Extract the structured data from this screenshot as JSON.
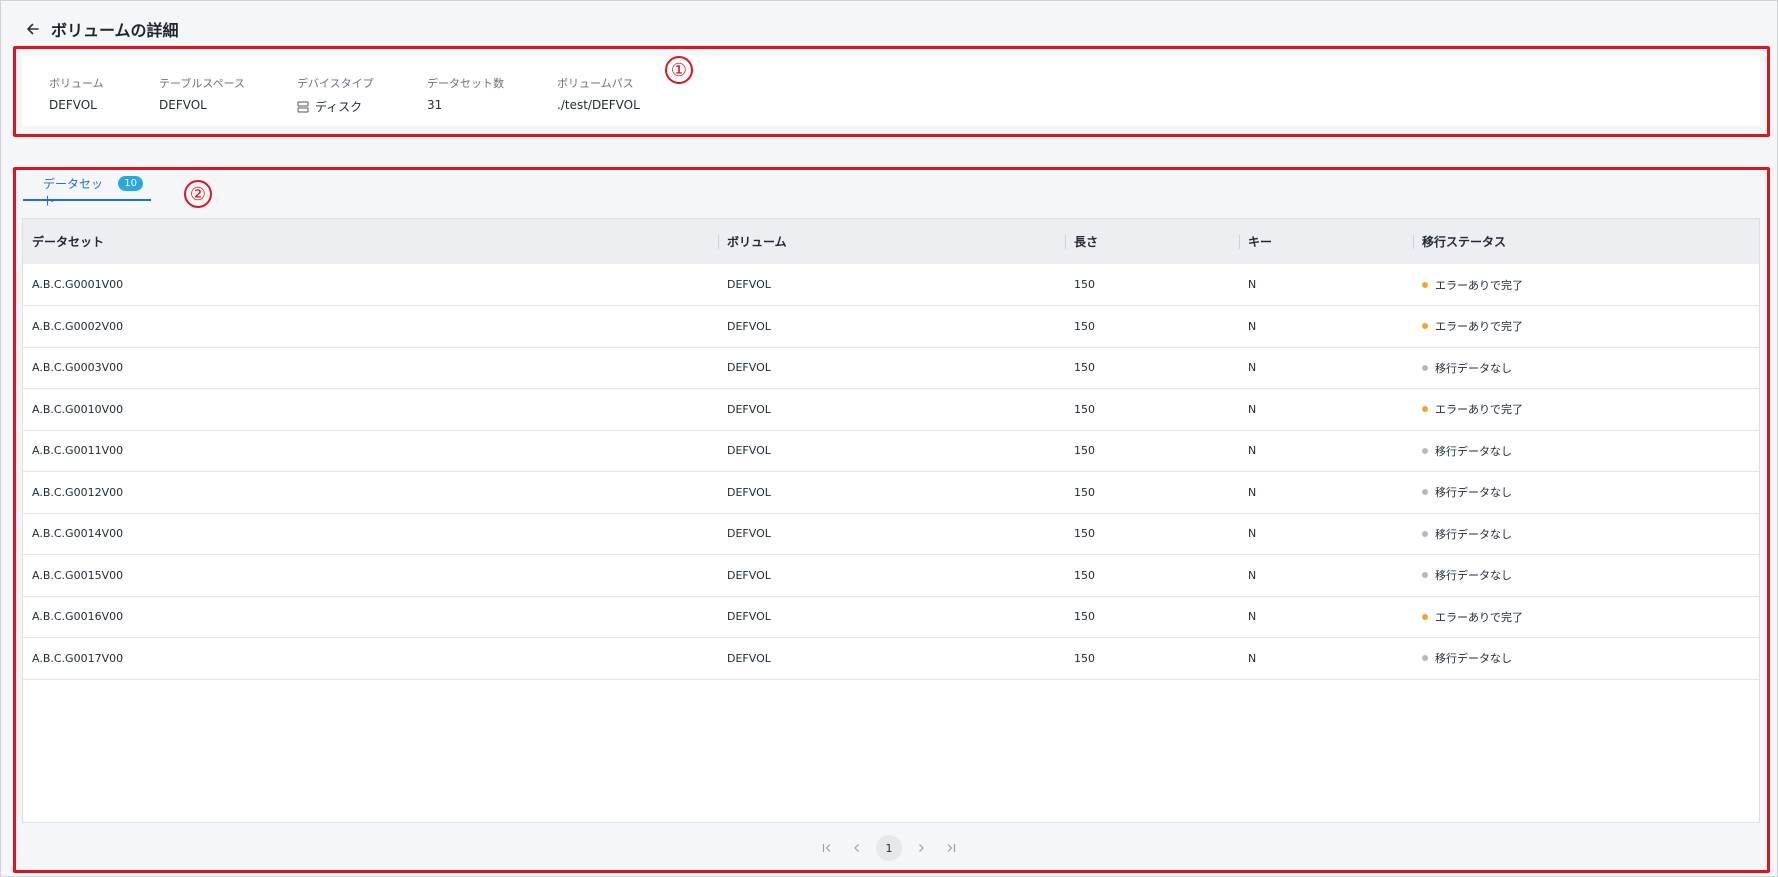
{
  "header": {
    "title": "ボリュームの詳細",
    "back_icon": "arrow-left-icon"
  },
  "annotations": {
    "first": "①",
    "second": "②"
  },
  "details": {
    "volume_label": "ボリューム",
    "volume_value": "DEFVOL",
    "tablespace_label": "テーブルスペース",
    "tablespace_value": "DEFVOL",
    "device_label": "デバイスタイプ",
    "device_value": "ディスク",
    "device_icon": "disk-icon",
    "dataset_count_label": "データセット数",
    "dataset_count_value": "31",
    "path_label": "ボリュームパス",
    "path_value": "./test/DEFVOL"
  },
  "tabs": [
    {
      "label": "データセット",
      "badge": "10",
      "active": true
    }
  ],
  "table": {
    "columns": [
      "データセット",
      "ボリューム",
      "長さ",
      "キー",
      "移行ステータス"
    ],
    "rows": [
      {
        "dataset": "A.B.C.G0001V00",
        "volume": "DEFVOL",
        "length": "150",
        "key": "N",
        "status": "エラーありで完了",
        "status_color": "#f5a623"
      },
      {
        "dataset": "A.B.C.G0002V00",
        "volume": "DEFVOL",
        "length": "150",
        "key": "N",
        "status": "エラーありで完了",
        "status_color": "#f5a623"
      },
      {
        "dataset": "A.B.C.G0003V00",
        "volume": "DEFVOL",
        "length": "150",
        "key": "N",
        "status": "移行データなし",
        "status_color": "#b5b9bf"
      },
      {
        "dataset": "A.B.C.G0010V00",
        "volume": "DEFVOL",
        "length": "150",
        "key": "N",
        "status": "エラーありで完了",
        "status_color": "#f5a623"
      },
      {
        "dataset": "A.B.C.G0011V00",
        "volume": "DEFVOL",
        "length": "150",
        "key": "N",
        "status": "移行データなし",
        "status_color": "#b5b9bf"
      },
      {
        "dataset": "A.B.C.G0012V00",
        "volume": "DEFVOL",
        "length": "150",
        "key": "N",
        "status": "移行データなし",
        "status_color": "#b5b9bf"
      },
      {
        "dataset": "A.B.C.G0014V00",
        "volume": "DEFVOL",
        "length": "150",
        "key": "N",
        "status": "移行データなし",
        "status_color": "#b5b9bf"
      },
      {
        "dataset": "A.B.C.G0015V00",
        "volume": "DEFVOL",
        "length": "150",
        "key": "N",
        "status": "移行データなし",
        "status_color": "#b5b9bf"
      },
      {
        "dataset": "A.B.C.G0016V00",
        "volume": "DEFVOL",
        "length": "150",
        "key": "N",
        "status": "エラーありで完了",
        "status_color": "#f5a623"
      },
      {
        "dataset": "A.B.C.G0017V00",
        "volume": "DEFVOL",
        "length": "150",
        "key": "N",
        "status": "移行データなし",
        "status_color": "#b5b9bf"
      }
    ]
  },
  "pagination": {
    "current_page": "1"
  },
  "colors": {
    "accent": "#1f6fd1",
    "badge": "#27a8e0",
    "annotation": "#e0141e",
    "warning_dot": "#f5a623",
    "neutral_dot": "#b5b9bf"
  }
}
